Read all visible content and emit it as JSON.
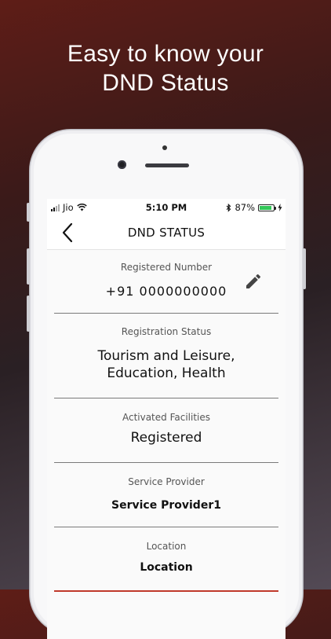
{
  "headline": {
    "line1": "Easy to know your",
    "line2": "DND Status"
  },
  "status_bar": {
    "carrier": "Jio",
    "time": "5:10 PM",
    "battery_percent": "87%",
    "battery_level": 0.87,
    "icons": [
      "signal-icon",
      "wifi-icon",
      "bluetooth-icon",
      "battery-icon",
      "charging-icon"
    ]
  },
  "nav": {
    "title": "DND STATUS",
    "back_icon": "chevron-left-icon"
  },
  "details": {
    "registered_number": {
      "label": "Registered Number",
      "value": "+91 0000000000",
      "edit_icon": "pencil-icon"
    },
    "registration_status": {
      "label": "Registration Status",
      "value": "Tourism and Leisure,\nEducation,  Health"
    },
    "activated_facilities": {
      "label": "Activated Facilities",
      "value": "Registered"
    },
    "service_provider": {
      "label": "Service Provider",
      "value": "Service Provider1"
    },
    "location": {
      "label": "Location",
      "value": "Location"
    }
  },
  "colors": {
    "battery_fill": "#34c759",
    "accent_divider": "#c0392b",
    "text": "#111111"
  }
}
